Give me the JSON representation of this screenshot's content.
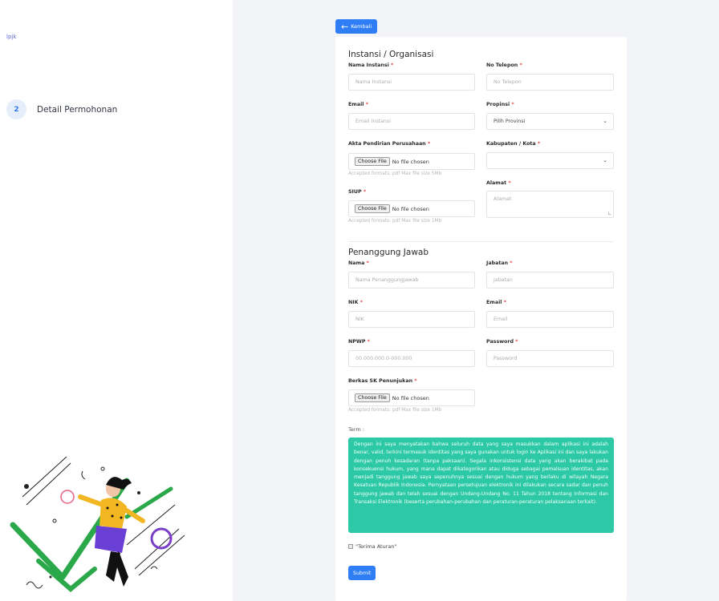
{
  "brand": "lpjk",
  "step": {
    "number": "2",
    "label": "Detail Permohonan"
  },
  "back_label": "Kembali",
  "org": {
    "title": "Instansi / Organisasi",
    "nama_label": "Nama Instansi",
    "nama_placeholder": "Nama Instansi",
    "telp_label": "No Telepon",
    "telp_placeholder": "No Telepon",
    "email_label": "Email",
    "email_placeholder": "Email Instansi",
    "prov_label": "Propinsi",
    "prov_value": "Pilih Provinsi",
    "akta_label": "Akta Pendirian Perusahaan",
    "akta_hint": "Accepted formats: pdf Max file size 5Mb",
    "kab_label": "Kabupaten / Kota",
    "kab_value": "",
    "alamat_label": "Alamat",
    "alamat_placeholder": "Alamat",
    "siup_label": "SIUP",
    "siup_hint": "Accepted formats: pdf Max file size 1Mb"
  },
  "file_input": {
    "button": "Choose File",
    "status": "No file chosen"
  },
  "pj": {
    "title": "Penanggung Jawab",
    "nama_label": "Nama",
    "nama_placeholder": "Nama Penanggungjawab",
    "jabatan_label": "Jabatan",
    "jabatan_placeholder": "Jabatan",
    "nik_label": "NIK",
    "nik_placeholder": "NIK",
    "email_label": "Email",
    "email_placeholder": "Email",
    "npwp_label": "NPWP",
    "npwp_placeholder": "00.000.000.0-000.000",
    "password_label": "Password",
    "password_placeholder": "Password",
    "sk_label": "Berkas SK Penunjukan",
    "sk_hint": "Accepted formats: pdf Max file size 1Mb"
  },
  "required_mark": "*",
  "term_label": "Term :",
  "term_text": "Dengan ini saya menyatakan bahwa seluruh data yang saya masukkan dalam aplikasi ini adalah benar, valid, terkini termasuk identitas yang saya gunakan untuk login ke Aplikasi ini dan saya lakukan dengan penuh kesadaran (tanpa paksaan). Segala inkonsistensi data yang akan berakibat pada konsekuensi hukum, yang mana dapat dikategorikan atau diduga sebagai pemalsuan identitas, akan menjadi tanggung jawab saya sepenuhnya sesuai dengan hukum yang berlaku di wilayah Negara Kesatuan Republik Indonesia. Pernyataan persetujuan elektronik ini dilakukan secara sadar dan penuh tanggung jawab dan telah sesuai dengan Undang-Undang No. 11 Tahun 2018 tentang Informasi dan Transaksi Elektronik (beserta perubahan-perubahan dan peraturan-peraturan pelaksanaan terkait).",
  "accept_label": "\"Terima Aturan\"",
  "submit_label": "Submit",
  "colors": {
    "primary": "#2f7ef6",
    "term_bg": "#2dc9a6",
    "required": "#e64a4a",
    "page_bg": "#f3f4f7"
  }
}
